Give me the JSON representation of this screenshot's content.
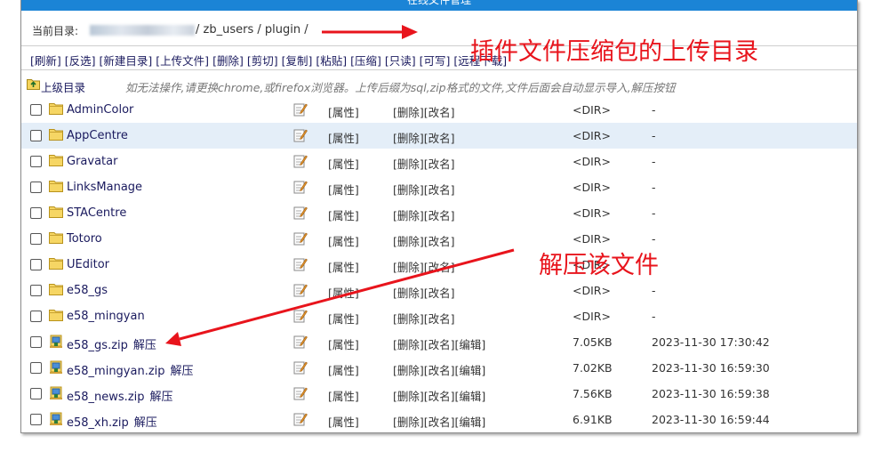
{
  "window": {
    "title": "在线文件管理"
  },
  "path": {
    "label": "当前目录:",
    "segments": "/ zb_users / plugin /"
  },
  "toolbar": [
    {
      "label": "[刷新]"
    },
    {
      "label": "[反选]"
    },
    {
      "label": "[新建目录]"
    },
    {
      "label": "[上传文件]"
    },
    {
      "label": "[删除]"
    },
    {
      "label": "[剪切]"
    },
    {
      "label": "[复制]"
    },
    {
      "label": "[粘贴]"
    },
    {
      "label": "[压缩]"
    },
    {
      "label": "[只读]"
    },
    {
      "label": "[可写]"
    },
    {
      "label": "[远程下载]"
    }
  ],
  "up": {
    "label": "上级目录",
    "hint": "如无法操作,请更换chrome,或firefox浏览器。上传后缀为sql,zip格式的文件,文件后面会自动显示导入,解压按钮"
  },
  "action_labels": {
    "prop": "[属性]",
    "del": "[删除]",
    "rename": "[改名]",
    "edit": "[编辑]",
    "extract": "解压"
  },
  "files": [
    {
      "name": "AdminColor",
      "type": "dir",
      "size": "<DIR>",
      "date": "-"
    },
    {
      "name": "AppCentre",
      "type": "dir",
      "size": "<DIR>",
      "date": "-"
    },
    {
      "name": "Gravatar",
      "type": "dir",
      "size": "<DIR>",
      "date": "-"
    },
    {
      "name": "LinksManage",
      "type": "dir",
      "size": "<DIR>",
      "date": "-"
    },
    {
      "name": "STACentre",
      "type": "dir",
      "size": "<DIR>",
      "date": "-"
    },
    {
      "name": "Totoro",
      "type": "dir",
      "size": "<DIR>",
      "date": "-"
    },
    {
      "name": "UEditor",
      "type": "dir",
      "size": "<DIR>",
      "date": "-"
    },
    {
      "name": "e58_gs",
      "type": "dir",
      "size": "<DIR>",
      "date": "-"
    },
    {
      "name": "e58_mingyan",
      "type": "dir",
      "size": "<DIR>",
      "date": "-"
    },
    {
      "name": "e58_gs.zip",
      "type": "zip",
      "size": "7.05KB",
      "date": "2023-11-30 17:30:42"
    },
    {
      "name": "e58_mingyan.zip",
      "type": "zip",
      "size": "7.02KB",
      "date": "2023-11-30 16:59:30"
    },
    {
      "name": "e58_news.zip",
      "type": "zip",
      "size": "7.56KB",
      "date": "2023-11-30 16:59:38"
    },
    {
      "name": "e58_xh.zip",
      "type": "zip",
      "size": "6.91KB",
      "date": "2023-11-30 16:59:44"
    }
  ],
  "annotations": {
    "upload_dir": "插件文件压缩包的上传目录",
    "extract": "解压该文件"
  },
  "colors": {
    "annotation": "#e8141c",
    "titlebar": "#1b84d6",
    "link": "#1a1a5e",
    "highlight": "#e4eef8"
  }
}
